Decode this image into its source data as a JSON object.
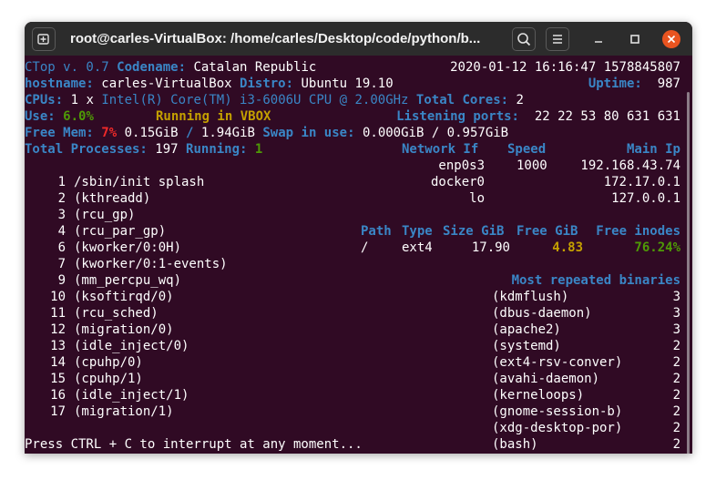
{
  "window": {
    "title": "root@carles-VirtualBox: /home/carles/Desktop/code/python/b...",
    "icons": [
      "new-tab-icon",
      "search-icon",
      "hamburger-menu-icon",
      "minimize-icon",
      "maximize-icon",
      "close-icon"
    ]
  },
  "header": {
    "app": "CTop v. 0.7",
    "codename_label": "Codename:",
    "codename": "Catalan Republic",
    "datetime": "2020-01-12 16:16:47 1578845807",
    "hostname_label": "hostname:",
    "hostname": "carles-VirtualBox",
    "distro_label": "Distro:",
    "distro": "Ubuntu 19.10",
    "uptime_label": "Uptime:",
    "uptime": "987",
    "cpus_label": "CPUs:",
    "cpus": "1 x",
    "cpu_model": "Intel(R) Core(TM) i3-6006U CPU @ 2.00GHz",
    "total_cores_label": "Total Cores:",
    "total_cores": "2",
    "use_label": "Use:",
    "use": "6.0%",
    "running_in": "Running in VBOX",
    "listening_label": "Listening ports:",
    "listening_ports": "22 22 53 80 631 631",
    "free_mem_label": "Free Mem:",
    "free_mem_pct": "7%",
    "free_mem": "0.15GiB",
    "mem_sep": "/",
    "total_mem": "1.94GiB",
    "swap_label": "Swap in use:",
    "swap": "0.000GiB / 0.957GiB",
    "total_proc_label": "Total Processes:",
    "total_proc": "197",
    "running_label": "Running:",
    "running": "1"
  },
  "network": {
    "headers": {
      "iface": "Network If",
      "speed": "Speed",
      "ip": "Main Ip"
    },
    "rows": [
      {
        "iface": "enp0s3",
        "speed": "1000",
        "ip": "192.168.43.74"
      },
      {
        "iface": "docker0",
        "speed": "",
        "ip": "172.17.0.1"
      },
      {
        "iface": "lo",
        "speed": "",
        "ip": "127.0.0.1"
      }
    ]
  },
  "disk": {
    "headers": {
      "path": "Path",
      "type": "Type",
      "size": "Size GiB",
      "free": "Free GiB",
      "inodes": "Free inodes"
    },
    "rows": [
      {
        "path": "/",
        "type": "ext4",
        "size": "17.90",
        "free": "4.83",
        "inodes": "76.24%"
      }
    ]
  },
  "processes": [
    {
      "pid": "1",
      "name": "/sbin/init splash"
    },
    {
      "pid": "2",
      "name": "(kthreadd)"
    },
    {
      "pid": "3",
      "name": "(rcu_gp)"
    },
    {
      "pid": "4",
      "name": "(rcu_par_gp)"
    },
    {
      "pid": "6",
      "name": "(kworker/0:0H)"
    },
    {
      "pid": "7",
      "name": "(kworker/0:1-events)"
    },
    {
      "pid": "9",
      "name": "(mm_percpu_wq)"
    },
    {
      "pid": "10",
      "name": "(ksoftirqd/0)"
    },
    {
      "pid": "11",
      "name": "(rcu_sched)"
    },
    {
      "pid": "12",
      "name": "(migration/0)"
    },
    {
      "pid": "13",
      "name": "(idle_inject/0)"
    },
    {
      "pid": "14",
      "name": "(cpuhp/0)"
    },
    {
      "pid": "15",
      "name": "(cpuhp/1)"
    },
    {
      "pid": "16",
      "name": "(idle_inject/1)"
    },
    {
      "pid": "17",
      "name": "(migration/1)"
    }
  ],
  "binaries": {
    "title": "Most repeated binaries",
    "rows": [
      {
        "name": "(kdmflush)",
        "count": "3"
      },
      {
        "name": "(dbus-daemon)",
        "count": "3"
      },
      {
        "name": "(apache2)",
        "count": "3"
      },
      {
        "name": "(systemd)",
        "count": "2"
      },
      {
        "name": "(ext4-rsv-conver)",
        "count": "2"
      },
      {
        "name": "(avahi-daemon)",
        "count": "2"
      },
      {
        "name": "(kerneloops)",
        "count": "2"
      },
      {
        "name": "(gnome-session-b)",
        "count": "2"
      },
      {
        "name": "(xdg-desktop-por)",
        "count": "2"
      },
      {
        "name": "(bash)",
        "count": "2"
      }
    ]
  },
  "footer": "Press CTRL + C to interrupt at any moment..."
}
